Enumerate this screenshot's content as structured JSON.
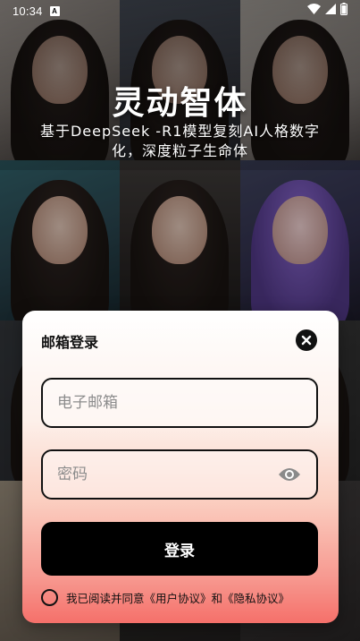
{
  "status_bar": {
    "time": "10:34",
    "notification_badge": "A"
  },
  "hero": {
    "title": "灵动智体",
    "subtitle": "基于DeepSeek -R1模型复刻AI人格数字化，深度粒子生命体"
  },
  "login_modal": {
    "title": "邮箱登录",
    "email_placeholder": "电子邮箱",
    "email_value": "",
    "password_placeholder": "密码",
    "password_value": "",
    "login_label": "登录",
    "agreement": {
      "prefix": "我已阅读并同意",
      "user_agreement": "《用户协议》",
      "conjunction": "和",
      "privacy_policy": "《隐私协议》",
      "checked": false
    }
  },
  "icons": {
    "close": "close-icon",
    "eye": "eye-icon",
    "wifi": "wifi-icon",
    "signal": "signal-icon",
    "battery": "battery-icon"
  },
  "colors": {
    "modal_gradient_top": "#ffffff",
    "modal_gradient_bottom": "#f5706a",
    "button_bg": "#000000",
    "text_primary": "#111111"
  }
}
